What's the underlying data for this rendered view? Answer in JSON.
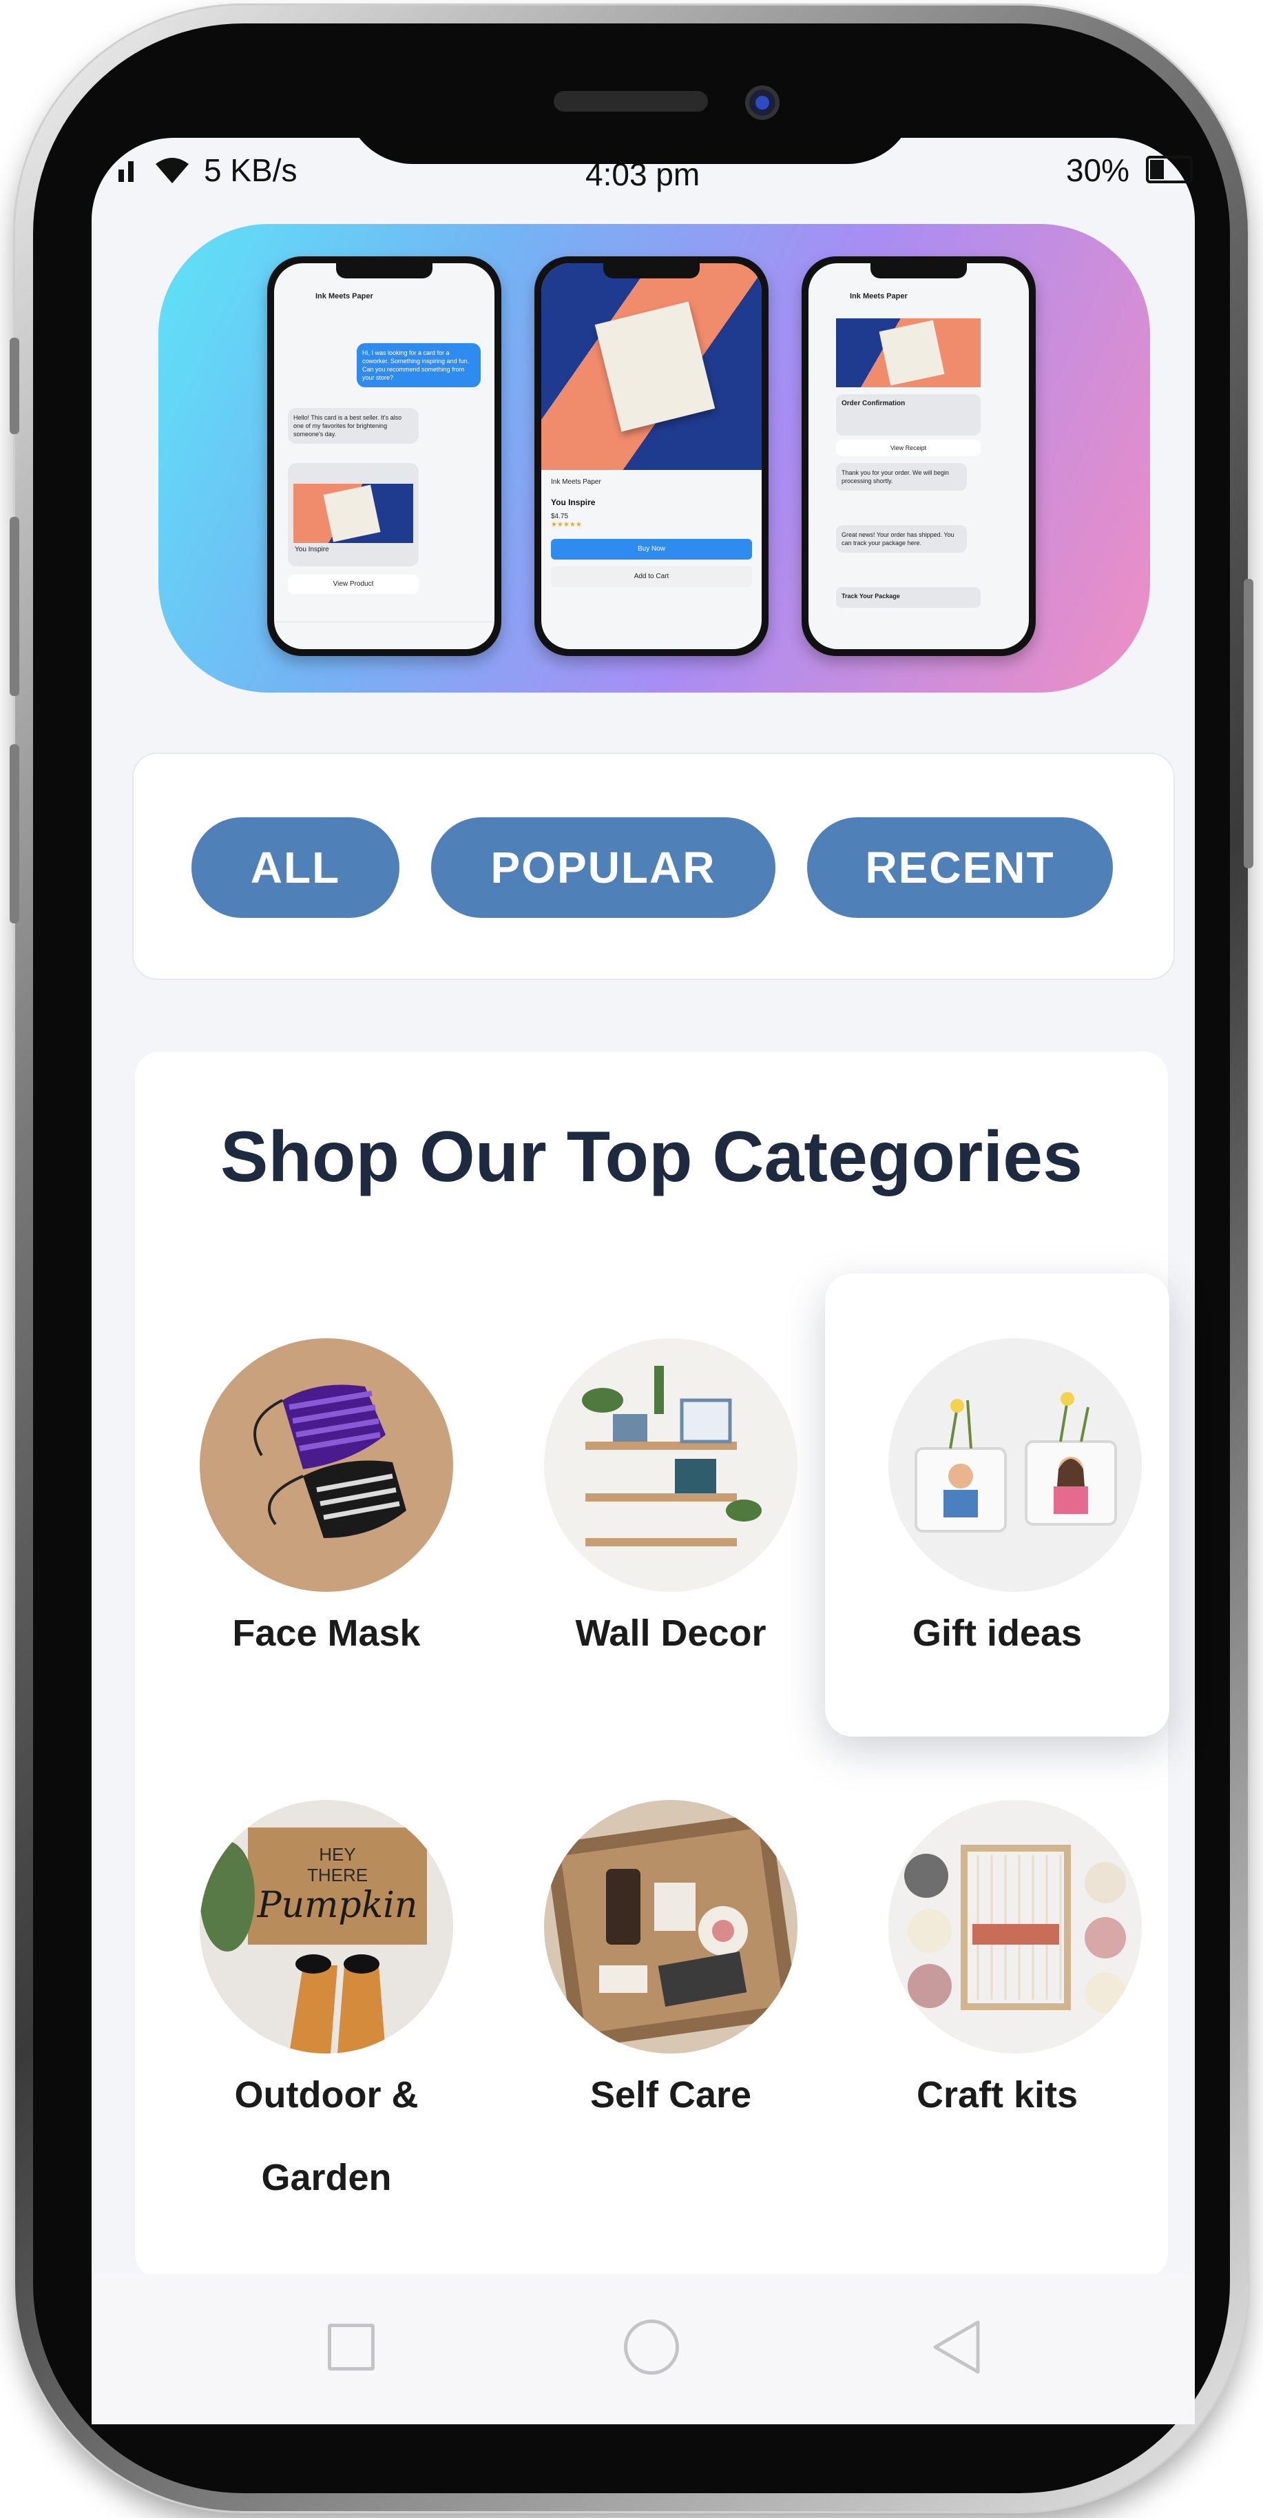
{
  "status_bar": {
    "network_speed": "5 KB/s",
    "time": "4:03 pm",
    "battery": "30%"
  },
  "banner": {
    "phone1": {
      "header": "Ink Meets Paper",
      "bubble_out": "Hi, I was looking for a card for a coworker. Something inspiring and fun. Can you recommend something from your store?",
      "bubble_in": "Hello! This card is a best seller. It's also one of my favorites for brightening someone's day.",
      "product": "You Inspire",
      "button": "View Product"
    },
    "phone2": {
      "shop": "Ink Meets Paper",
      "product": "You Inspire",
      "price": "$4.75",
      "buy": "Buy Now",
      "cart": "Add to Cart"
    },
    "phone3": {
      "header": "Ink Meets Paper",
      "order": "Order Confirmation",
      "view_receipt": "View Receipt",
      "thanks": "Thank you for your order. We will begin processing shortly.",
      "shipped": "Great news! Your order has shipped. You can track your package here.",
      "track": "Track Your Package"
    }
  },
  "filters": [
    "ALL",
    "POPULAR",
    "RECENT"
  ],
  "categories": {
    "title": "Shop Our Top Categories",
    "items": [
      {
        "label": "Face Mask"
      },
      {
        "label": "Wall Decor"
      },
      {
        "label": "Gift ideas"
      },
      {
        "label": "Outdoor &",
        "label2": "Garden"
      },
      {
        "label": "Self Care"
      },
      {
        "label": "Craft kits"
      }
    ]
  },
  "colors": {
    "pill": "#4f80b8",
    "title": "#1d2a3f",
    "screen_bg": "#f4f5f8"
  },
  "icons": [
    "wifi-icon",
    "signal-icon",
    "battery-icon",
    "recent-apps-icon",
    "home-icon",
    "back-icon"
  ]
}
